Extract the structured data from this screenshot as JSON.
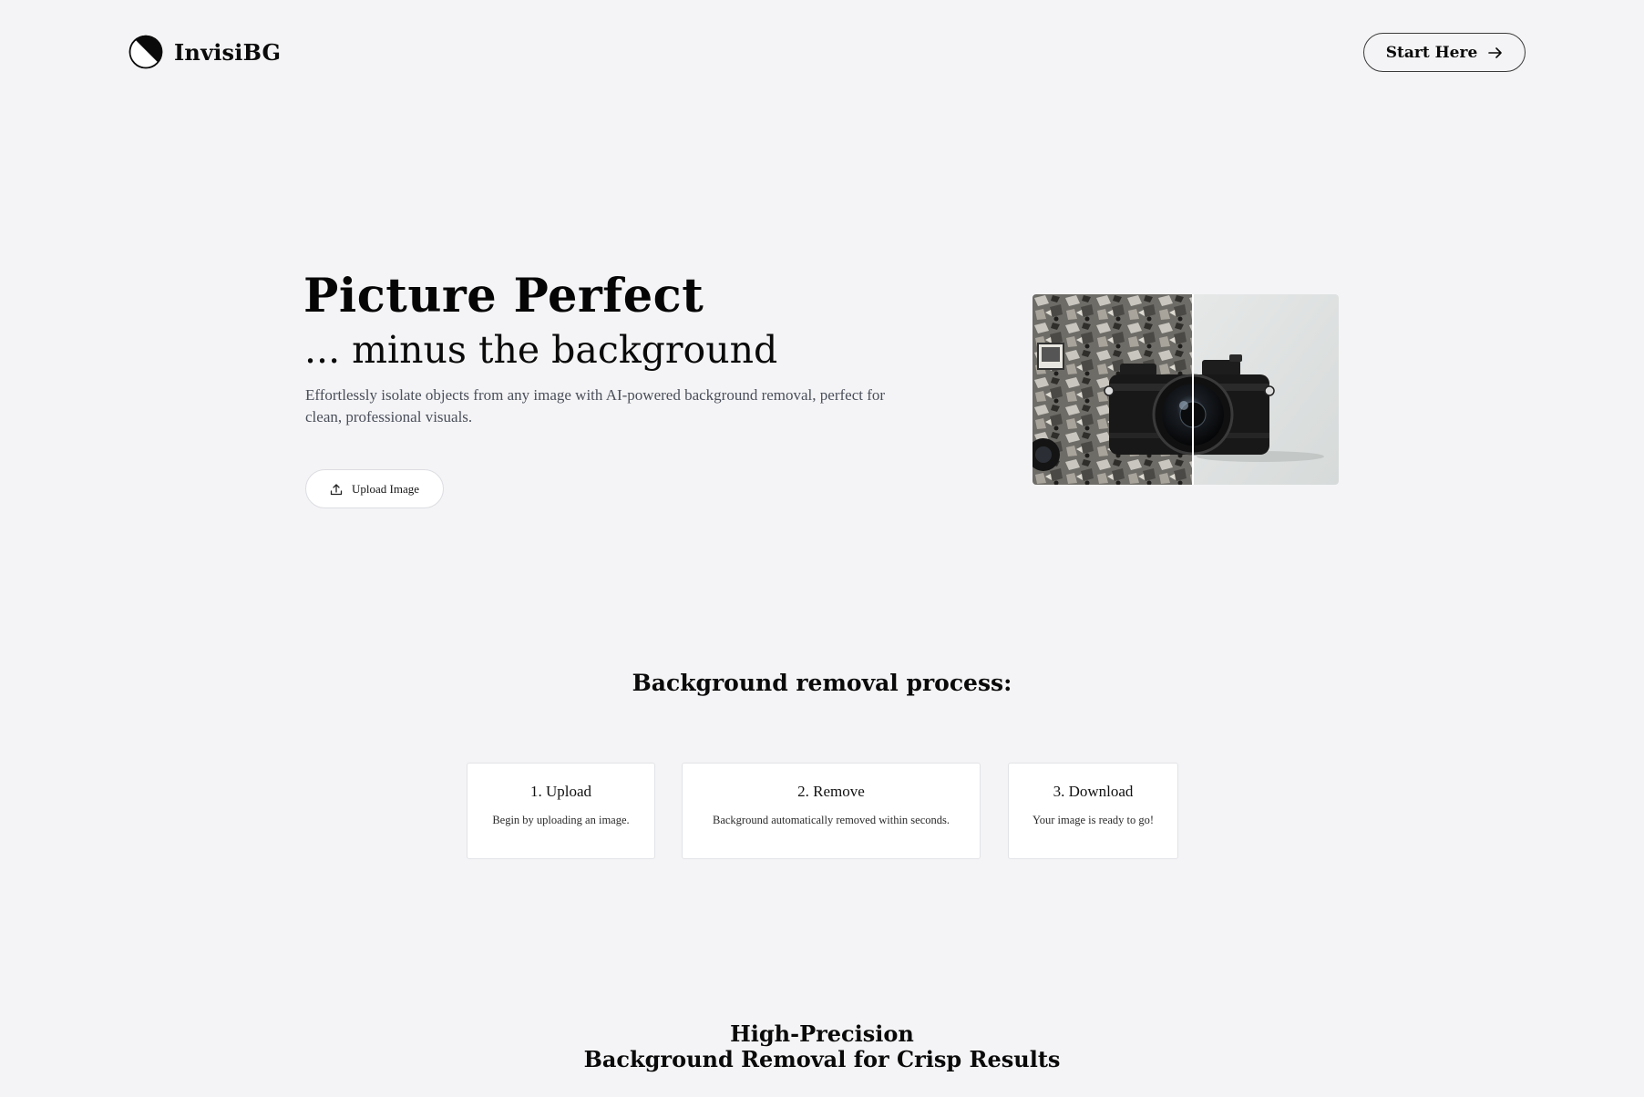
{
  "header": {
    "brand_name": "InvisiBG",
    "logo_icon": "half-moon-logo-icon",
    "start_button_label": "Start Here",
    "start_button_icon": "arrow-right-icon"
  },
  "hero": {
    "title": "Picture Perfect",
    "subtitle": "... minus the background",
    "description": "Effortlessly isolate objects from any image with AI-powered background removal, perfect for clean, professional visuals.",
    "upload_button_label": "Upload Image",
    "upload_button_icon": "upload-icon"
  },
  "process": {
    "title": "Background removal process:",
    "steps": [
      {
        "title": "1. Upload",
        "description": "Begin by uploading an image."
      },
      {
        "title": "2. Remove",
        "description": "Background automatically removed within seconds."
      },
      {
        "title": "3. Download",
        "description": "Your image is ready to go!"
      }
    ]
  },
  "precision": {
    "title_line_1": "High-Precision",
    "title_line_2": "Background Removal for Crisp Results"
  },
  "colors": {
    "page_background": "#f4f4f6",
    "text_primary": "#0a0a0a",
    "text_muted": "#4a4f5a",
    "card_background": "#ffffff",
    "card_border": "#e2e3e7"
  }
}
